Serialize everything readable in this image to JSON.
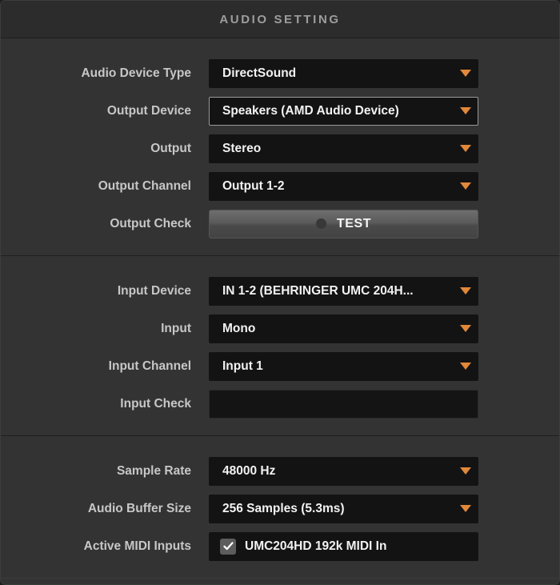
{
  "window": {
    "title": "AUDIO SETTING"
  },
  "colors": {
    "panel_bg": "#333333",
    "header_bg": "#2c2c2c",
    "field_bg": "#131313",
    "accent_arrow": "#e1883a",
    "label_text": "#c7c7c7",
    "value_text": "#f2f2f2",
    "title_text": "#9d9d9d",
    "focus_border": "#9a9a9a"
  },
  "sections": [
    {
      "name": "output-section",
      "rows": [
        {
          "label": "Audio Device Type",
          "type": "dropdown",
          "value": "DirectSound",
          "focused": false,
          "arrow_icon": "chevron-down-icon"
        },
        {
          "label": "Output Device",
          "type": "dropdown",
          "value": "Speakers (AMD Audio Device)",
          "focused": true,
          "arrow_icon": "chevron-down-icon"
        },
        {
          "label": "Output",
          "type": "dropdown",
          "value": "Stereo",
          "focused": false,
          "arrow_icon": "chevron-down-icon"
        },
        {
          "label": "Output Channel",
          "type": "dropdown",
          "value": "Output 1-2",
          "focused": false,
          "arrow_icon": "chevron-down-icon"
        },
        {
          "label": "Output Check",
          "type": "button",
          "value": "TEST",
          "dot_icon": "circle-icon"
        }
      ]
    },
    {
      "name": "input-section",
      "rows": [
        {
          "label": "Input Device",
          "type": "dropdown",
          "value": "IN 1-2 (BEHRINGER UMC 204H...",
          "focused": false,
          "arrow_icon": "chevron-down-icon"
        },
        {
          "label": "Input",
          "type": "dropdown",
          "value": "Mono",
          "focused": false,
          "arrow_icon": "chevron-down-icon"
        },
        {
          "label": "Input Channel",
          "type": "dropdown",
          "value": "Input 1",
          "focused": false,
          "arrow_icon": "chevron-down-icon"
        },
        {
          "label": "Input Check",
          "type": "meter",
          "value": ""
        }
      ]
    },
    {
      "name": "format-section",
      "rows": [
        {
          "label": "Sample Rate",
          "type": "dropdown",
          "value": "48000 Hz",
          "focused": false,
          "arrow_icon": "chevron-down-icon"
        },
        {
          "label": "Audio Buffer Size",
          "type": "dropdown",
          "value": "256 Samples (5.3ms)",
          "focused": false,
          "arrow_icon": "chevron-down-icon"
        },
        {
          "label": "Active MIDI Inputs",
          "type": "checkbox",
          "value": "UMC204HD 192k MIDI In",
          "checked": true,
          "check_icon": "checkmark-icon"
        }
      ]
    }
  ]
}
